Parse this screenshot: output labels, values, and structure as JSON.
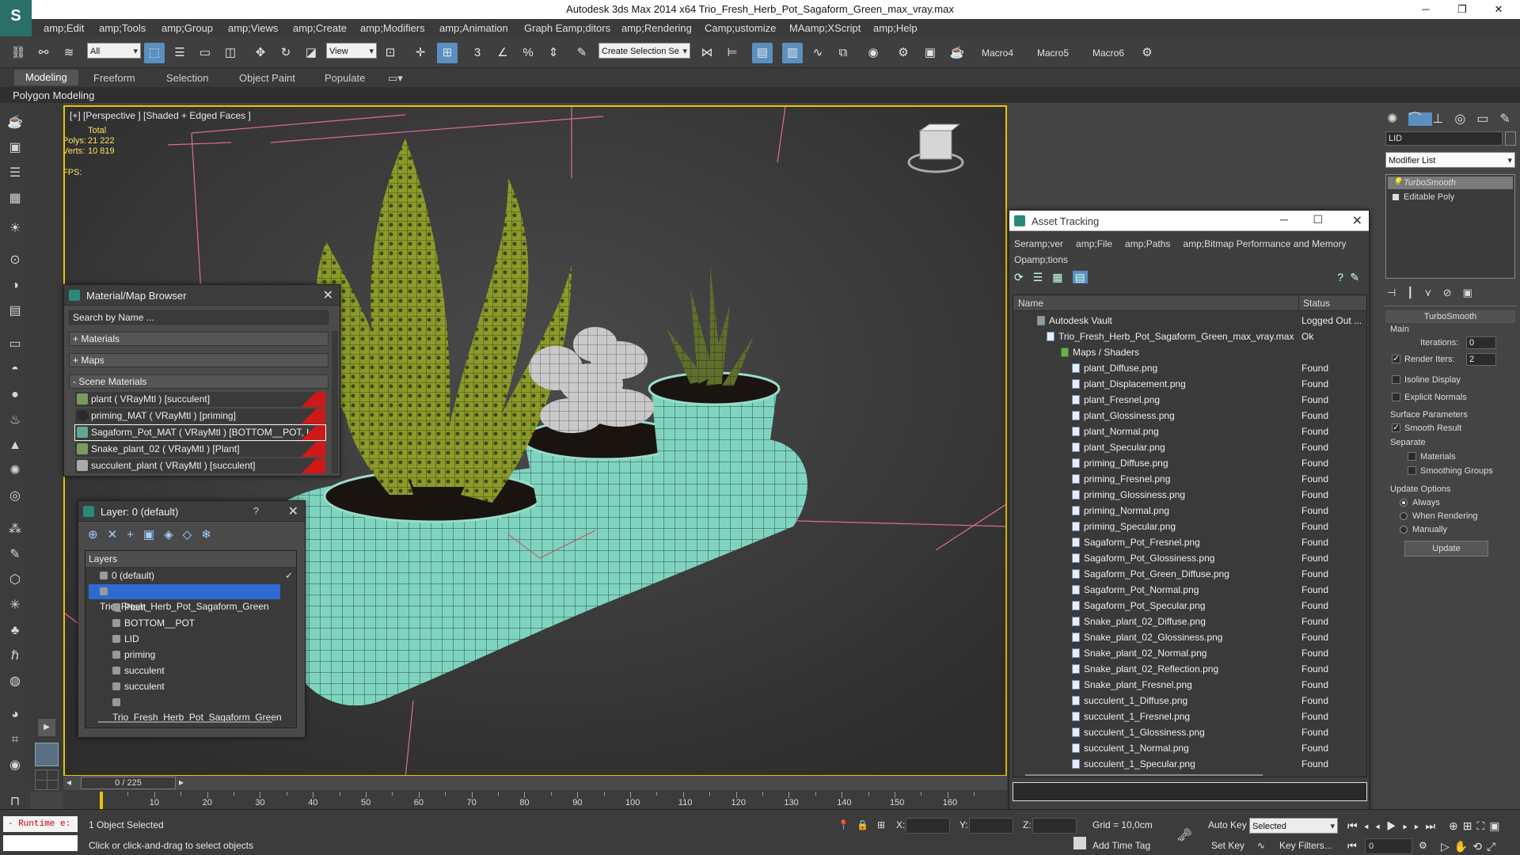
{
  "window": {
    "title": "Autodesk 3ds Max  2014 x64     Trio_Fresh_Herb_Pot_Sagaform_Green_max_vray.max"
  },
  "menu": [
    "amp;Edit",
    "amp;Tools",
    "amp;Group",
    "amp;Views",
    "amp;Create",
    "amp;Modifiers",
    "amp;Animation",
    "Graph Eamp;ditors",
    "amp;Rendering",
    "Camp;ustomize",
    "MAamp;XScript",
    "amp;Help"
  ],
  "toolbar": {
    "filter": "All",
    "refcoord": "View",
    "selset": "Create Selection Se",
    "macros": [
      "Macro4",
      "Macro5",
      "Macro6"
    ]
  },
  "ribbon": {
    "tabs": [
      "Modeling",
      "Freeform",
      "Selection",
      "Object Paint",
      "Populate"
    ],
    "sub": "Polygon Modeling"
  },
  "viewport": {
    "label": "[+] [Perspective ] [Shaded + Edged Faces ]",
    "total": "Total",
    "polys_label": "Polys:",
    "polys": "21 222",
    "verts_label": "Verts:",
    "verts": "10 819",
    "fps": "FPS:"
  },
  "matbrowser": {
    "title": "Material/Map Browser",
    "search": "Search by Name ...",
    "materials": "+ Materials",
    "maps": "+ Maps",
    "scene": "- Scene Materials",
    "items": [
      "plant ( VRayMtl ) [succulent]",
      "priming_MAT ( VRayMtl ) [priming]",
      "Sagaform_Pot_MAT ( VRayMtl ) [BOTTOM__POT, LID]",
      "Snake_plant_02 ( VRayMtl ) [Plant]",
      "succulent_plant ( VRayMtl ) [succulent]"
    ]
  },
  "layers": {
    "title": "Layer: 0 (default)",
    "header": "Layers",
    "question": "?",
    "rows": [
      "0 (default)",
      "Trio_Fresh_Herb_Pot_Sagaform_Green",
      "Plant",
      "BOTTOM__POT",
      "LID",
      "priming",
      "succulent",
      "succulent",
      "Trio_Fresh_Herb_Pot_Sagaform_Green"
    ]
  },
  "asset": {
    "title": "Asset Tracking",
    "menu": [
      "Seramp;ver",
      "amp;File",
      "amp;Paths",
      "amp;Bitmap Performance and Memory",
      "Opamp;tions"
    ],
    "col_name": "Name",
    "col_status": "Status",
    "vault": {
      "name": "Autodesk Vault",
      "status": "Logged Out ..."
    },
    "file": {
      "name": "Trio_Fresh_Herb_Pot_Sagaform_Green_max_vray.max",
      "status": "Ok"
    },
    "group": "Maps / Shaders",
    "maps": [
      "plant_Diffuse.png",
      "plant_Displacement.png",
      "plant_Fresnel.png",
      "plant_Glossiness.png",
      "plant_Normal.png",
      "plant_Specular.png",
      "priming_Diffuse.png",
      "priming_Fresnel.png",
      "priming_Glossiness.png",
      "priming_Normal.png",
      "priming_Specular.png",
      "Sagaform_Pot_Fresnel.png",
      "Sagaform_Pot_Glossiness.png",
      "Sagaform_Pot_Green_Diffuse.png",
      "Sagaform_Pot_Normal.png",
      "Sagaform_Pot_Specular.png",
      "Snake_plant_02_Diffuse.png",
      "Snake_plant_02_Glossiness.png",
      "Snake_plant_02_Normal.png",
      "Snake_plant_02_Reflection.png",
      "Snake_plant_Fresnel.png",
      "succulent_1_Diffuse.png",
      "succulent_1_Fresnel.png",
      "succulent_1_Glossiness.png",
      "succulent_1_Normal.png",
      "succulent_1_Specular.png"
    ],
    "found": "Found"
  },
  "cmdpanel": {
    "objname": "LID",
    "modlist": "Modifier List",
    "stack": [
      "TurboSmooth",
      "Editable Poly"
    ],
    "rollout": "TurboSmooth",
    "main": "Main",
    "iterations_label": "Iterations:",
    "iterations": "0",
    "render_iters_label": "Render Iters:",
    "render_iters": "2",
    "isoline": "Isoline Display",
    "explicit": "Explicit Normals",
    "surface": "Surface Parameters",
    "smooth": "Smooth Result",
    "separate": "Separate",
    "sep_mat": "Materials",
    "sep_sg": "Smoothing Groups",
    "update_opts": "Update Options",
    "always": "Always",
    "when_rendering": "When Rendering",
    "manually": "Manually",
    "update_btn": "Update"
  },
  "timeline": {
    "frame": "0 / 225",
    "ticks": [
      "10",
      "20",
      "30",
      "40",
      "50",
      "60",
      "70",
      "80",
      "90",
      "100",
      "110",
      "120",
      "130",
      "140",
      "150",
      "160"
    ]
  },
  "status": {
    "runtime": "- Runtime e:",
    "selected": "1 Object Selected",
    "prompt": "Click or click-and-drag to select objects",
    "x": "X:",
    "y": "Y:",
    "z": "Z:",
    "grid": "Grid = 10,0cm",
    "autokey": "Auto Key",
    "setkey": "Set Key",
    "keyfilter": "Selected",
    "keyfilters": "Key Filters...",
    "addtimetag": "Add Time Tag",
    "frame": "0"
  }
}
